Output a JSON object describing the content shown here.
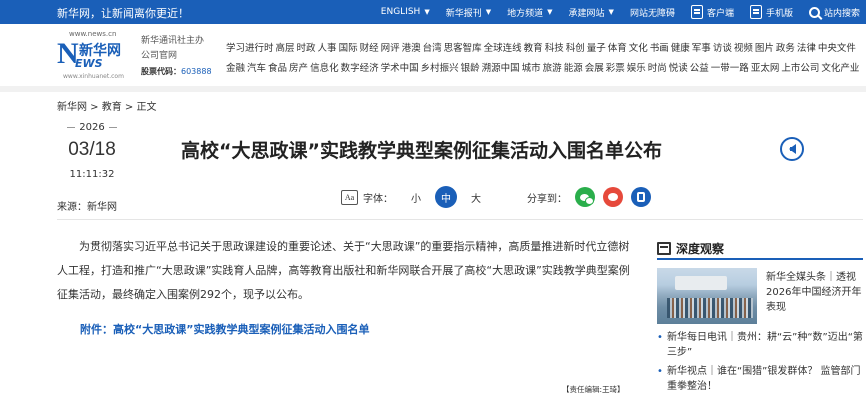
{
  "topbar": {
    "slogan": "新华网，让新闻离你更近！",
    "links": [
      {
        "label": "ENGLISH",
        "has_dropdown": true
      },
      {
        "label": "新华报刊",
        "has_dropdown": true
      },
      {
        "label": "地方频道",
        "has_dropdown": true
      },
      {
        "label": "承建网站",
        "has_dropdown": true
      },
      {
        "label": "网站无障碍",
        "has_dropdown": false
      }
    ],
    "client_label": "客户端",
    "mobile_label": "手机版",
    "search_label": "站内搜索"
  },
  "header": {
    "logo": {
      "url_text": "www.news.cn",
      "n_letter": "N",
      "cn_text": "新华网",
      "ews_text": "EWS",
      "site_text": "www.xinhuanet.com"
    },
    "org_line1": "新华通讯社主办",
    "org_line2": "公司官网",
    "stock_label": "股票代码：",
    "stock_code": "603888",
    "nav_row1": [
      "学习进行时",
      "高层",
      "时政",
      "人事",
      "国际",
      "财经",
      "网评",
      "港澳",
      "台湾",
      "思客智库",
      "全球连线",
      "教育",
      "科技",
      "科创",
      "量子",
      "体育",
      "文化",
      "书画",
      "健康",
      "军事",
      "访谈",
      "视频",
      "图片",
      "政务",
      "法律",
      "中央文件"
    ],
    "nav_row2": [
      "金融",
      "汽车",
      "食品",
      "房产",
      "信息化",
      "数字经济",
      "学术中国",
      "乡村振兴",
      "银龄",
      "溯源中国",
      "城市",
      "旅游",
      "能源",
      "会展",
      "彩票",
      "娱乐",
      "时尚",
      "悦读",
      "公益",
      "一带一路",
      "亚太网",
      "上市公司",
      "文化产业"
    ]
  },
  "breadcrumb": {
    "home": "新华网",
    "sep1": " > ",
    "section": "教育",
    "sep2": " > ",
    "current": "正文"
  },
  "article": {
    "year": "2026",
    "day": "03/18",
    "time": "11:11:32",
    "source": "来源：新华网",
    "title": "高校“大思政课”实践教学典型案例征集活动入围名单公布",
    "font_label": "字体：",
    "font_small": "小",
    "font_medium": "中",
    "font_large": "大",
    "share_label": "分享到：",
    "body": "为贯彻落实习近平总书记关于思政课建设的重要论述、关于“大思政课”的重要指示精神，高质量推进新时代立德树人工程，打造和推广“大思政课”实践育人品牌，高等教育出版社和新华网联合开展了高校“大思政课”实践教学典型案例征集活动，最终确定入围案例292个，现予以公布。",
    "attachment": "附件：高校“大思政课”实践教学典型案例征集活动入围名单",
    "editor": "【责任编辑:王琦】"
  },
  "sidebar": {
    "heading": "深度观察",
    "feature_text": "新华全媒头条｜透视2026年中国经济开年表现",
    "items": [
      "新华每日电讯｜贵州：耕“云”种“数”迈出“第三步”",
      "新华视点｜谁在“围猎”银发群体？ 监管部门重拳整治！"
    ]
  },
  "colors": {
    "brand_blue": "#1a5fb8",
    "wechat_green": "#2aae4b",
    "weibo_red": "#e6493b"
  }
}
